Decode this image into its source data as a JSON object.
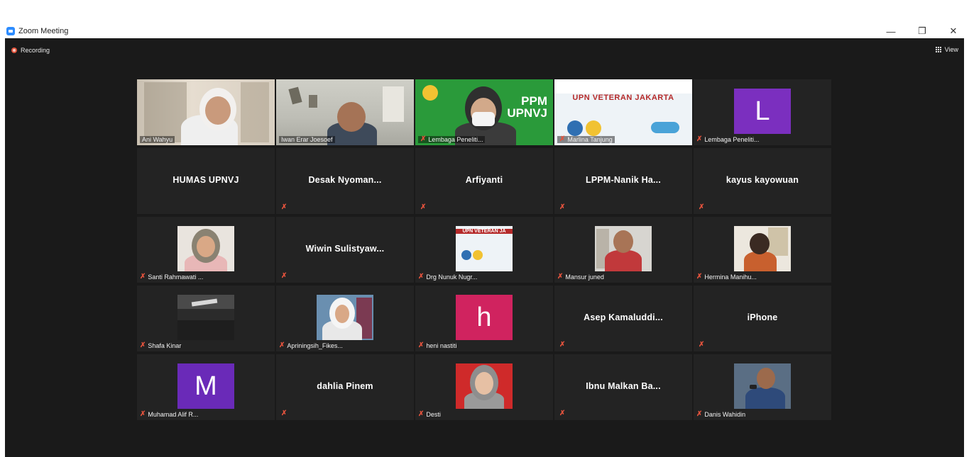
{
  "window": {
    "title": "Zoom Meeting",
    "minimize": "—",
    "restore": "❐",
    "close": "✕"
  },
  "toolbar": {
    "recording_label": "Recording",
    "view_label": "View"
  },
  "video_text": {
    "ppm": "PPM",
    "upnvj": "UPNVJ",
    "upn_banner": "UPN VETERAN JAKARTA",
    "upn_banner_small": "UPN VETERAN JA"
  },
  "participants": [
    {
      "name": "Ani Wahyu",
      "type": "video",
      "muted": false
    },
    {
      "name": "Iwan Erar Joesoef",
      "type": "video",
      "muted": false
    },
    {
      "name": "Lembaga Peneliti...",
      "type": "video",
      "muted": true
    },
    {
      "name": "Marlina Tanjung",
      "type": "video",
      "muted": true
    },
    {
      "name": "Lembaga Peneliti...",
      "type": "letter",
      "letter": "L",
      "muted": true
    },
    {
      "name": "HUMAS UPNVJ",
      "type": "text",
      "muted": false
    },
    {
      "name": "Desak Nyoman...",
      "type": "text",
      "muted": true
    },
    {
      "name": "Arfiyanti",
      "type": "text",
      "muted": true
    },
    {
      "name": "LPPM-Nanik Ha...",
      "type": "text",
      "muted": true
    },
    {
      "name": "kayus kayowuan",
      "type": "text",
      "muted": true
    },
    {
      "name": "Santi Rahmawati ...",
      "type": "photo",
      "muted": true
    },
    {
      "name": "Wiwin Sulistyaw...",
      "type": "text",
      "muted": true
    },
    {
      "name": "Drg Nunuk Nugr...",
      "type": "photo",
      "muted": true
    },
    {
      "name": "Mansur juned",
      "type": "photo",
      "muted": true
    },
    {
      "name": "Hermina Manihu...",
      "type": "photo",
      "muted": true
    },
    {
      "name": "Shafa Kinar",
      "type": "photo",
      "muted": true
    },
    {
      "name": "Apriningsih_Fikes...",
      "type": "photo",
      "muted": true
    },
    {
      "name": "heni nastiti",
      "type": "letter",
      "letter": "h",
      "muted": true
    },
    {
      "name": "Asep Kamaluddi...",
      "type": "text",
      "muted": true
    },
    {
      "name": "iPhone",
      "type": "text",
      "muted": true
    },
    {
      "name": "Muhamad Alif R...",
      "type": "letter",
      "letter": "M",
      "muted": true
    },
    {
      "name": "dahlia Pinem",
      "type": "text",
      "muted": true
    },
    {
      "name": "Desti",
      "type": "photo",
      "muted": true
    },
    {
      "name": "Ibnu Malkan Ba...",
      "type": "text",
      "muted": true
    },
    {
      "name": "Danis Wahidin",
      "type": "photo",
      "muted": true
    }
  ],
  "colors": {
    "active_speaker_border": "#b6e03a",
    "muted_icon": "#e5533d",
    "avatar_L": "#7b2fbf",
    "avatar_h": "#d0235f",
    "avatar_M": "#6a2ab8",
    "meeting_bg": "#1a1a1a",
    "tile_bg": "#232323"
  }
}
